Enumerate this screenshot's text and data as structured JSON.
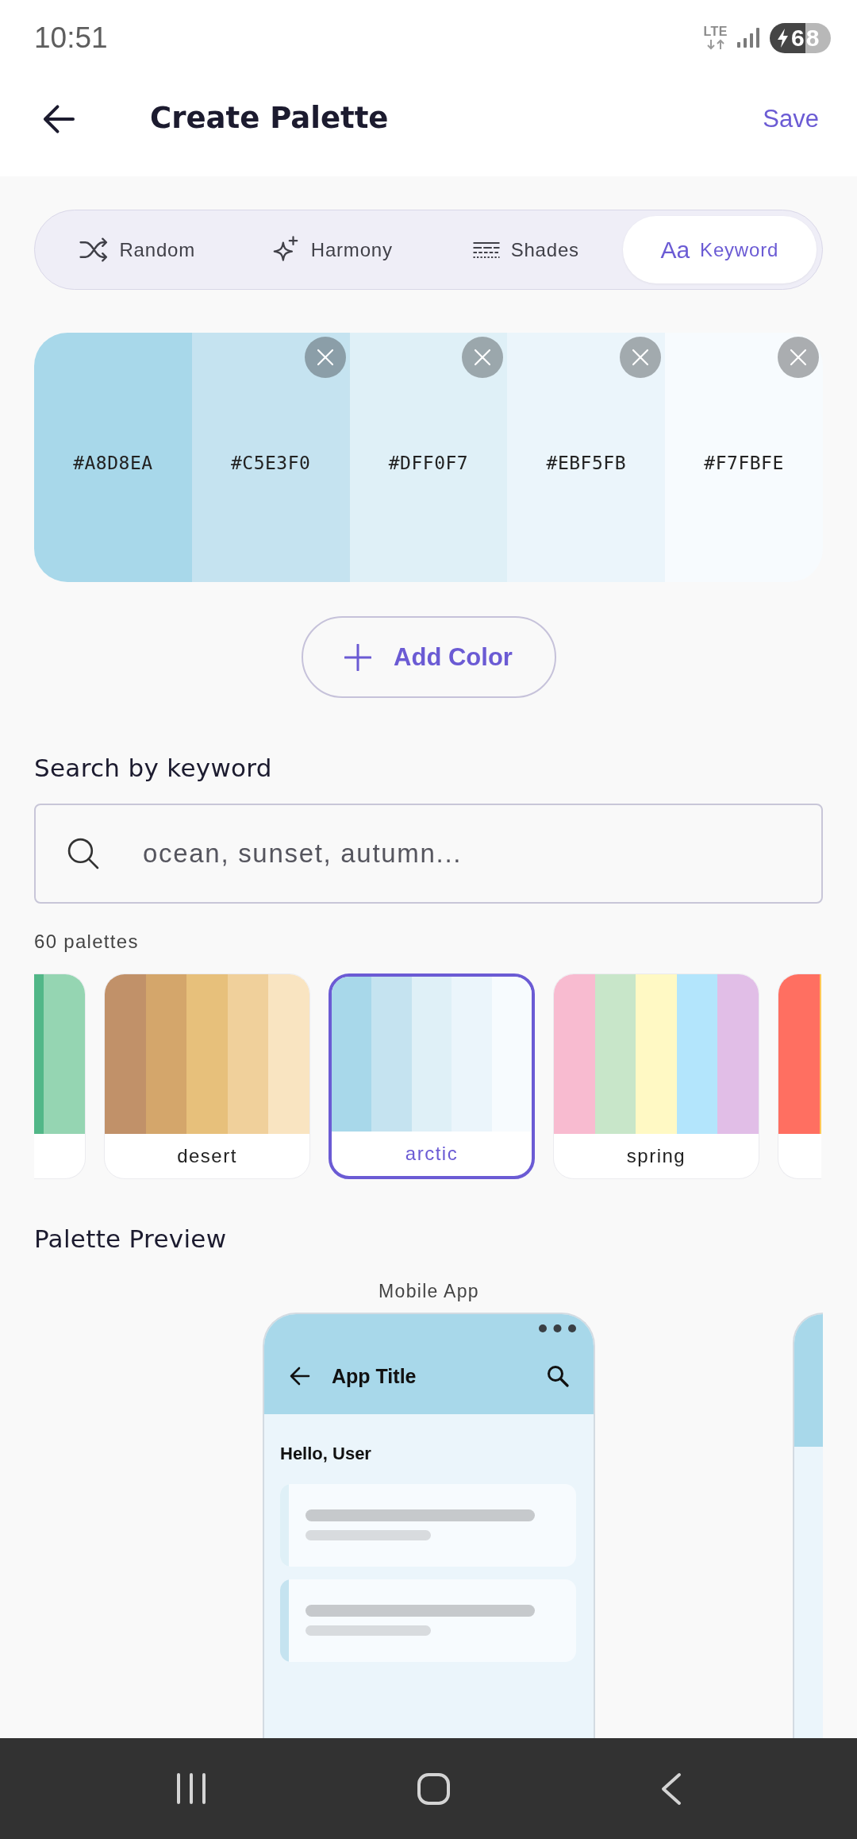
{
  "status_bar": {
    "time": "10:51",
    "network": "LTE",
    "battery": "68"
  },
  "header": {
    "title": "Create Palette",
    "action": "Save"
  },
  "tabs": [
    {
      "kind": "random",
      "label": "Random",
      "selected": false
    },
    {
      "kind": "harmony",
      "label": "Harmony",
      "selected": false
    },
    {
      "kind": "shades",
      "label": "Shades",
      "selected": false
    },
    {
      "kind": "keyword",
      "glyph": "Aa",
      "label": "Keyword",
      "selected": true
    }
  ],
  "swatches": [
    {
      "hex": "#A8D8EA",
      "color": "#a8d8ea",
      "removable": false
    },
    {
      "hex": "#C5E3F0",
      "color": "#c5e3f0",
      "removable": true
    },
    {
      "hex": "#DFF0F7",
      "color": "#dff0f7",
      "removable": true
    },
    {
      "hex": "#EBF5FB",
      "color": "#ebf5fb",
      "removable": true
    },
    {
      "hex": "#F7FBFE",
      "color": "#f7fbfe",
      "removable": true
    }
  ],
  "add_button": {
    "label": "Add Color"
  },
  "keyword_search": {
    "heading": "Search by keyword",
    "placeholder": "ocean, sunset, autumn...",
    "result_count": "60 palettes"
  },
  "palettes": [
    {
      "stripes": [
        {
          "color": "#52b788"
        },
        {
          "color": "#95d5b2"
        }
      ],
      "selected": false
    },
    {
      "name": "desert",
      "stripes": [
        {
          "color": "#c19169"
        },
        {
          "color": "#d4a66b"
        },
        {
          "color": "#e7c07b"
        },
        {
          "color": "#f0d09b"
        },
        {
          "color": "#f9e4c1"
        }
      ],
      "selected": false
    },
    {
      "name": "arctic",
      "stripes": [
        {
          "color": "#a8d8ea"
        },
        {
          "color": "#c5e3f0"
        },
        {
          "color": "#dff0f7"
        },
        {
          "color": "#ebf5fb"
        },
        {
          "color": "#f7fbfe"
        }
      ],
      "selected": true
    },
    {
      "name": "spring",
      "stripes": [
        {
          "color": "#f8bbd0"
        },
        {
          "color": "#c8e6c9"
        },
        {
          "color": "#fff9c4"
        },
        {
          "color": "#b3e5fc"
        },
        {
          "color": "#e1bee7"
        }
      ],
      "selected": false
    },
    {
      "stripes": [
        {
          "color": "#ff6f61"
        },
        {
          "color": "#ffc857"
        }
      ],
      "selected": false
    }
  ],
  "preview": {
    "heading": "Palette Preview",
    "items": [
      {
        "kind": "mobile",
        "label": "Mobile App",
        "app_title": "App Title",
        "greeting": "Hello, User",
        "cards": [
          {
            "color": "#dff0f7"
          },
          {
            "color": "#c5e3f0"
          }
        ]
      },
      {
        "kind": "partial"
      }
    ]
  }
}
